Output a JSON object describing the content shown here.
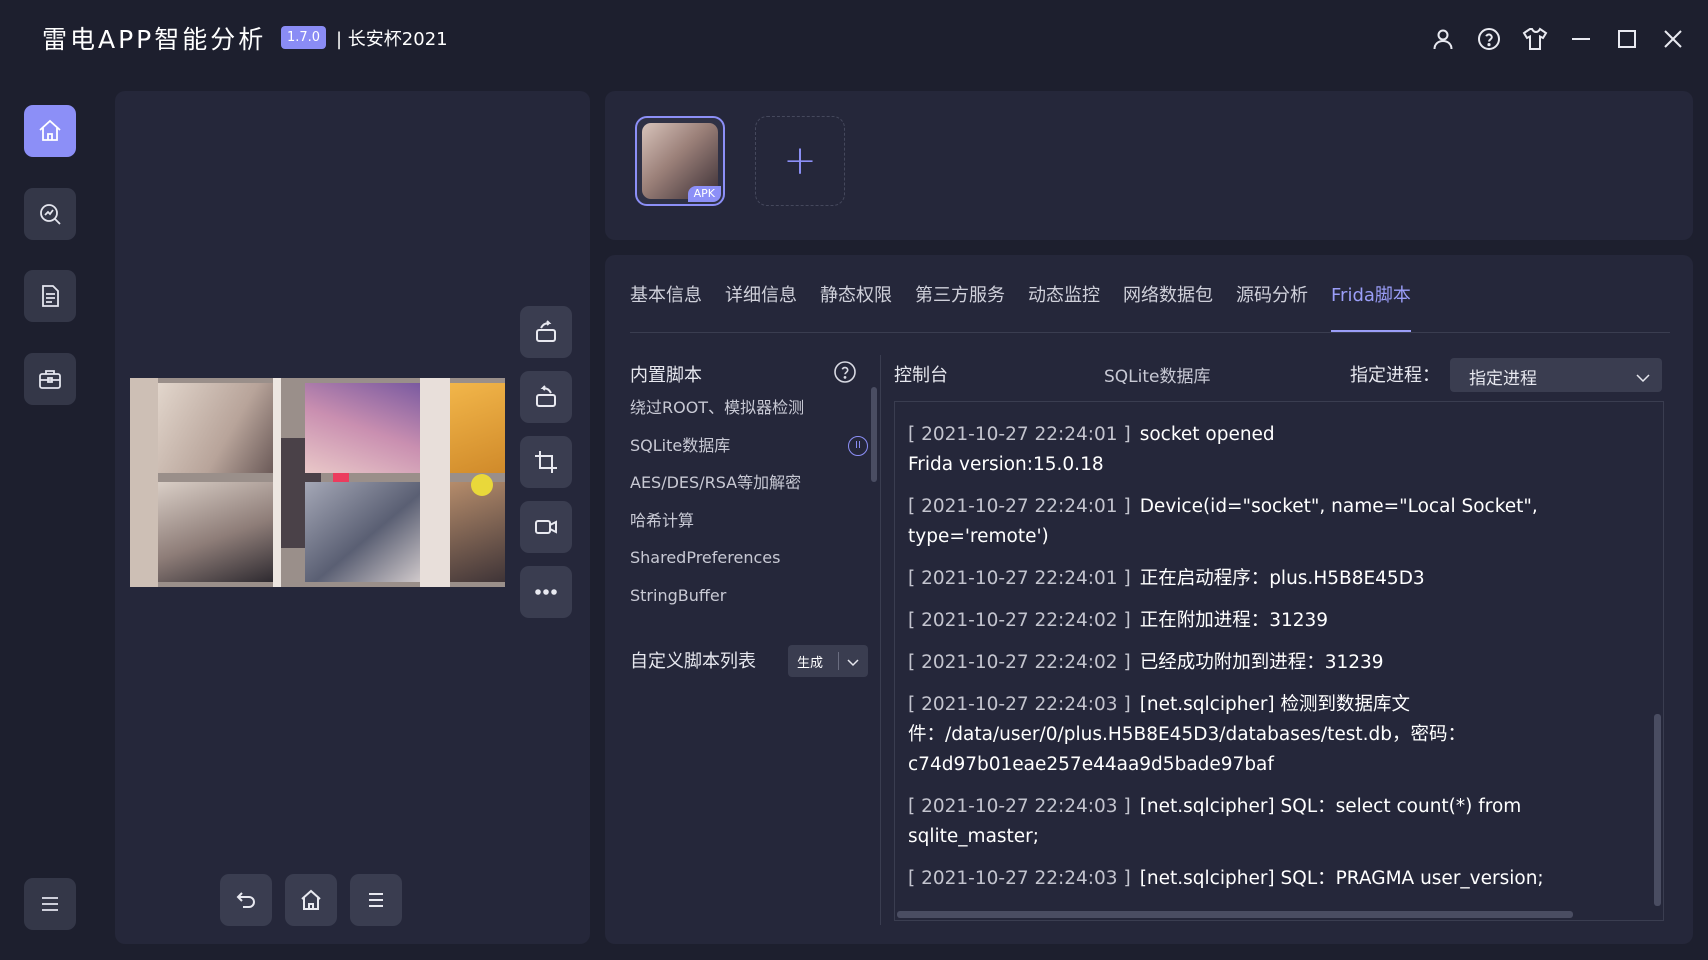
{
  "titlebar": {
    "app_title": "雷电APP智能分析",
    "version": "1.7.0",
    "event": "| 长安杯2021"
  },
  "apk": {
    "badge": "APK",
    "add_symbol": "+"
  },
  "tabs": [
    "基本信息",
    "详细信息",
    "静态权限",
    "第三方服务",
    "动态监控",
    "网络数据包",
    "源码分析",
    "Frida脚本"
  ],
  "scripts": {
    "builtin_title": "内置脚本",
    "items": [
      "绕过ROOT、模拟器检测",
      "SQLite数据库",
      "AES/DES/RSA等加解密",
      "哈希计算",
      "SharedPreferences",
      "StringBuffer"
    ],
    "custom_title": "自定义脚本列表",
    "generate_label": "生成"
  },
  "console": {
    "title": "控制台",
    "sqlite_label": "SQLite数据库",
    "process_label": "指定进程：",
    "process_value": "指定进程",
    "logs": [
      {
        "ts": "[ 2021-10-27 22:24:01 ]",
        "msg": "socket opened"
      },
      {
        "ts": "",
        "msg": "Frida version:15.0.18"
      },
      {
        "ts": "[ 2021-10-27 22:24:01 ]",
        "msg": "Device(id=\"socket\", name=\"Local Socket\", type='remote')"
      },
      {
        "ts": "[ 2021-10-27 22:24:01 ]",
        "msg": "正在启动程序：plus.H5B8E45D3"
      },
      {
        "ts": "[ 2021-10-27 22:24:02 ]",
        "msg": "正在附加进程：31239"
      },
      {
        "ts": "[ 2021-10-27 22:24:02 ]",
        "msg": "已经成功附加到进程：31239"
      },
      {
        "ts": "[ 2021-10-27 22:24:03 ]",
        "msg": "[net.sqlcipher] 检测到数据库文件：/data/user/0/plus.H5B8E45D3/databases/test.db，密码：c74d97b01eae257e44aa9d5bade97baf"
      },
      {
        "ts": "[ 2021-10-27 22:24:03 ]",
        "msg": "[net.sqlcipher] SQL：select count(*) from sqlite_master;"
      },
      {
        "ts": "[ 2021-10-27 22:24:03 ]",
        "msg": "[net.sqlcipher] SQL：PRAGMA user_version;"
      }
    ]
  },
  "icons": {
    "window": [
      "user-icon",
      "help-icon",
      "skin-icon",
      "minimize-icon",
      "maximize-icon",
      "close-icon"
    ],
    "nav": [
      "home-icon",
      "analysis-icon",
      "document-icon",
      "toolbox-icon",
      "menu-icon"
    ],
    "device_tools": [
      "rotate-left-icon",
      "rotate-right-icon",
      "crop-icon",
      "record-icon",
      "more-icon"
    ],
    "device_nav": [
      "back-icon",
      "home-icon",
      "menu-icon"
    ]
  },
  "colors": {
    "accent": "#8c8ff7",
    "background": "#1d1f2e",
    "panel": "#25273a"
  }
}
